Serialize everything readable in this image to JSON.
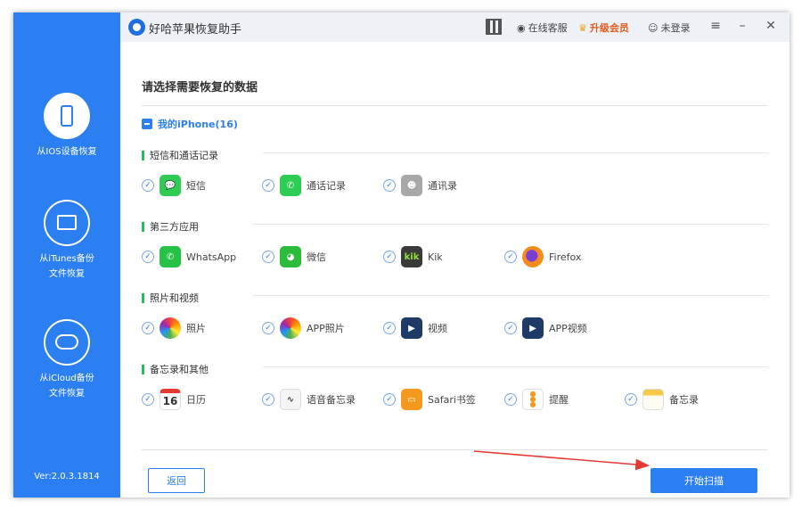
{
  "app": {
    "title": "好哈苹果恢复助手"
  },
  "titlebar": {
    "service": "在线客服",
    "upgrade": "升级会员",
    "login": "未登录",
    "menu": "≡",
    "minimize": "–",
    "close": "✕"
  },
  "sidebar": {
    "items": [
      {
        "line1": "从IOS设备恢复",
        "line2": ""
      },
      {
        "line1": "从iTunes备份",
        "line2": "文件恢复"
      },
      {
        "line1": "从iCloud备份",
        "line2": "文件恢复"
      }
    ],
    "version": "Ver:2.0.3.1814"
  },
  "main": {
    "heading": "请选择需要恢复的数据",
    "device": "我的iPhone(16)",
    "categories": [
      {
        "title": "短信和通话记录",
        "items": [
          "短信",
          "通话记录",
          "通讯录"
        ]
      },
      {
        "title": "第三方应用",
        "items": [
          "WhatsApp",
          "微信",
          "Kik",
          "Firefox"
        ]
      },
      {
        "title": "照片和视频",
        "items": [
          "照片",
          "APP照片",
          "视频",
          "APP视频"
        ]
      },
      {
        "title": "备忘录和其他",
        "items": [
          "日历",
          "语音备忘录",
          "Safari书签",
          "提醒",
          "备忘录"
        ]
      }
    ],
    "calendar_day": "16",
    "kik_icon_text": "kik",
    "check_glyph": "✓"
  },
  "buttons": {
    "back": "返回",
    "scan": "开始扫描"
  },
  "colors": {
    "accent": "#2b7ff0",
    "category_bar": "#22c05a",
    "arrow": "#e53935"
  }
}
